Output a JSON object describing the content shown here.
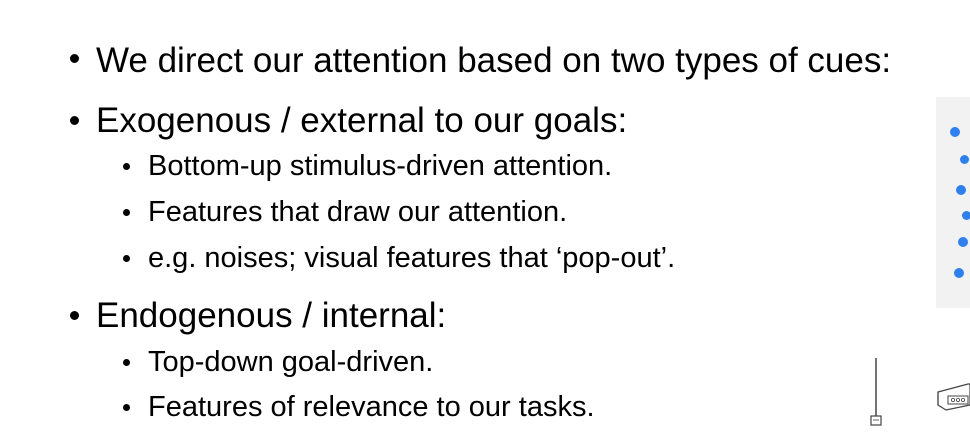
{
  "bullets": {
    "cue_types": "We direct our attention based on two types of cues:",
    "exogenous": {
      "heading": "Exogenous / external to our goals:",
      "items": [
        "Bottom-up stimulus-driven attention.",
        "Features that draw our attention.",
        "e.g. noises; visual features that ‘pop-out’."
      ]
    },
    "endogenous": {
      "heading": "Endogenous / internal:",
      "items": [
        "Top-down goal-driven.",
        "Features of relevance to our tasks."
      ]
    }
  },
  "figure": {
    "dot_color": "#2f80ed",
    "panel_color": "#f2f2f2"
  }
}
